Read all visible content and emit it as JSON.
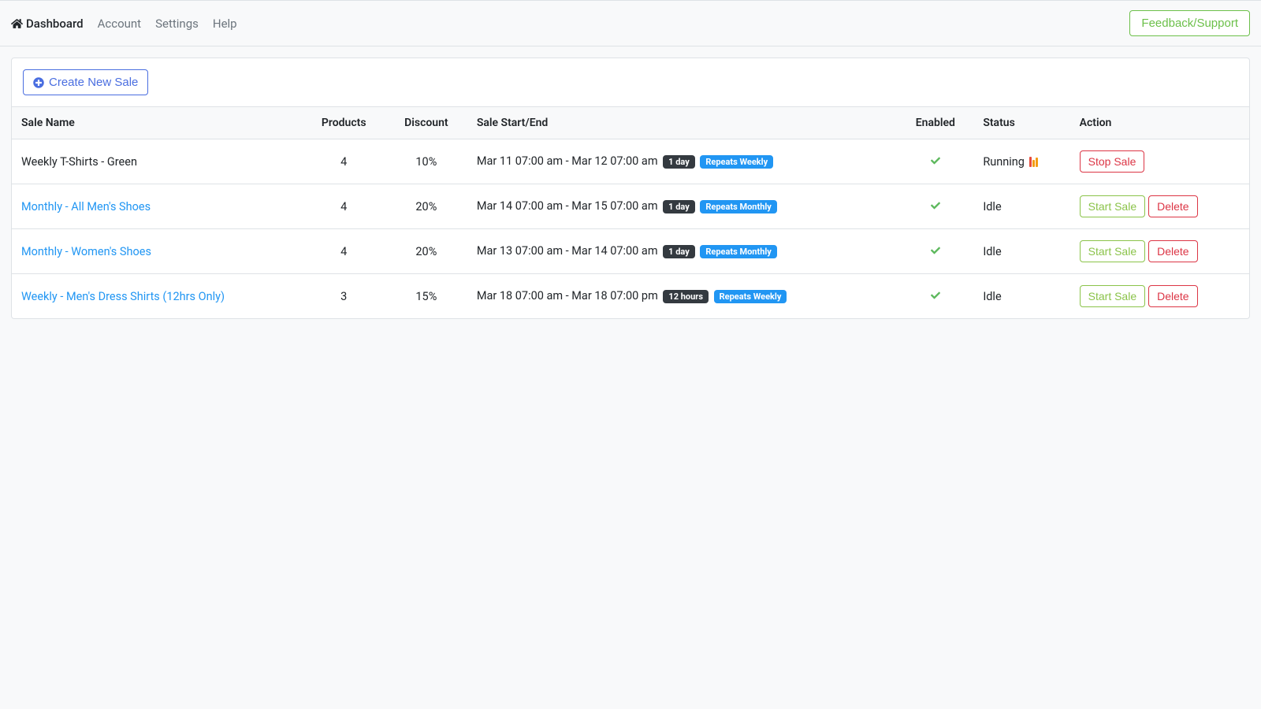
{
  "nav": {
    "dashboard": "Dashboard",
    "account": "Account",
    "settings": "Settings",
    "help": "Help",
    "feedback": "Feedback/Support"
  },
  "panel": {
    "create_sale": "Create New Sale"
  },
  "table": {
    "headers": {
      "sale_name": "Sale Name",
      "products": "Products",
      "discount": "Discount",
      "start_end": "Sale Start/End",
      "enabled": "Enabled",
      "status": "Status",
      "action": "Action"
    }
  },
  "actions": {
    "stop": "Stop Sale",
    "start": "Start Sale",
    "delete": "Delete"
  },
  "rows": [
    {
      "name": "Weekly T-Shirts - Green",
      "link": false,
      "products": "4",
      "discount": "10%",
      "range": "Mar 11 07:00 am - Mar 12 07:00 am",
      "duration": "1 day",
      "repeat": "Repeats Weekly",
      "status": "Running",
      "running": true
    },
    {
      "name": "Monthly - All Men's Shoes",
      "link": true,
      "products": "4",
      "discount": "20%",
      "range": "Mar 14 07:00 am - Mar 15 07:00 am",
      "duration": "1 day",
      "repeat": "Repeats Monthly",
      "status": "Idle",
      "running": false
    },
    {
      "name": "Monthly - Women's Shoes",
      "link": true,
      "products": "4",
      "discount": "20%",
      "range": "Mar 13 07:00 am - Mar 14 07:00 am",
      "duration": "1 day",
      "repeat": "Repeats Monthly",
      "status": "Idle",
      "running": false
    },
    {
      "name": "Weekly - Men's Dress Shirts (12hrs Only)",
      "link": true,
      "products": "3",
      "discount": "15%",
      "range": "Mar 18 07:00 am - Mar 18 07:00 pm",
      "duration": "12 hours",
      "repeat": "Repeats Weekly",
      "status": "Idle",
      "running": false
    }
  ]
}
